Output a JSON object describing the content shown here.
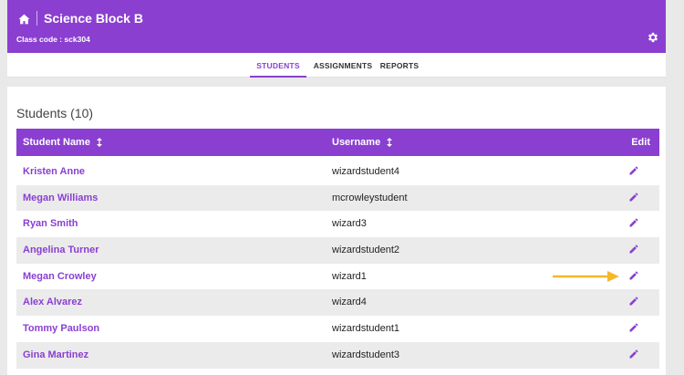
{
  "header": {
    "class_title": "Science Block B",
    "class_code": "Class code : sck304",
    "home_icon": "home-icon",
    "settings_icon": "gear-icon"
  },
  "tabs": [
    {
      "label": "STUDENTS",
      "active": true
    },
    {
      "label": "ASSIGNMENTS",
      "active": false
    },
    {
      "label": "REPORTS",
      "active": false
    }
  ],
  "section": {
    "title": "Students (10)"
  },
  "table": {
    "columns": {
      "name": "Student Name",
      "username": "Username",
      "edit": "Edit"
    },
    "rows": [
      {
        "name": "Kristen Anne",
        "username": "wizardstudent4"
      },
      {
        "name": "Megan Williams",
        "username": "mcrowleystudent"
      },
      {
        "name": "Ryan Smith",
        "username": "wizard3"
      },
      {
        "name": "Angelina Turner",
        "username": "wizardstudent2"
      },
      {
        "name": "Megan Crowley",
        "username": "wizard1"
      },
      {
        "name": "Alex Alvarez",
        "username": "wizard4"
      },
      {
        "name": "Tommy Paulson",
        "username": "wizardstudent1"
      },
      {
        "name": "Gina Martinez",
        "username": "wizardstudent3"
      }
    ]
  },
  "colors": {
    "accent": "#8a3fd1",
    "arrow": "#f5b82a",
    "row_alt": "#ebebeb"
  }
}
